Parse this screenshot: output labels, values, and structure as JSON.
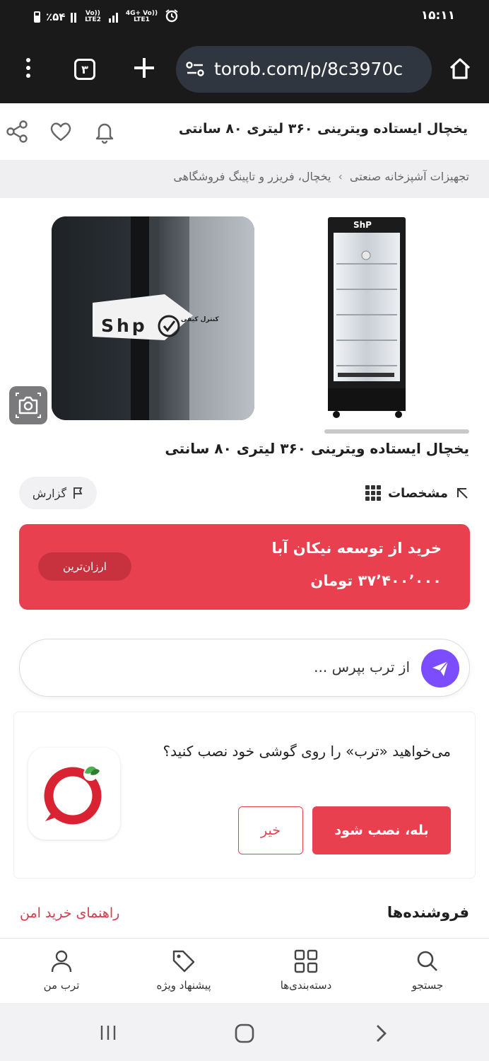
{
  "status_bar": {
    "battery": "٪۵۴",
    "network1": "Vo)) LTE2",
    "network2": "4G+ Vo)) LTE1",
    "time": "۱۵:۱۱"
  },
  "browser": {
    "tab_count": "۳",
    "url": "torob.com/p/8c3970c"
  },
  "header": {
    "title": "یخچال ایستاده ویترینی ۳۶۰ لیتری ۸۰ سانتی"
  },
  "breadcrumb": {
    "items": [
      "تجهیزات آشپزخانه صنعتی",
      "یخچال، فریزر و تاپینگ فروشگاهی"
    ]
  },
  "gallery": {
    "fridge_brand": "ShP",
    "sticker_brand": "Shp",
    "sticker_text": "کنترل کیفی"
  },
  "product": {
    "title": "یخچال ایستاده ویترینی ۳۶۰ لیتری ۸۰ سانتی",
    "specs_label": "مشخصات",
    "report_label": "گزارش"
  },
  "offer": {
    "seller_line": "خرید از توسعه نیکان آبا",
    "price": "۳۷٬۴۰۰٬۰۰۰ تومان",
    "badge": "ارزان‌ترین"
  },
  "ask": {
    "placeholder": "از ترب بپرس ..."
  },
  "install_banner": {
    "message": "می‌خواهید «ترب» را روی گوشی خود نصب کنید؟",
    "yes_label": "بله، نصب شود",
    "no_label": "خیر"
  },
  "sellers": {
    "title": "فروشنده‌ها",
    "safe_guide": "راهنمای خرید امن"
  },
  "bottom_nav": {
    "search": "جستجو",
    "categories": "دسته‌بندی‌ها",
    "offers": "پیشنهاد ویژه",
    "my_torob": "ترب من"
  },
  "colors": {
    "brand_red": "#e8404f",
    "ask_purple": "#7c4dff"
  }
}
